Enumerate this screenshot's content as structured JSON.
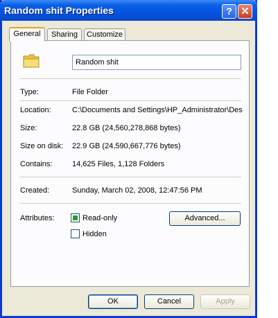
{
  "window": {
    "title": "Random shit Properties",
    "help_label": "?",
    "close_label": "✕"
  },
  "tabs": [
    {
      "label": "General",
      "active": true
    },
    {
      "label": "Sharing",
      "active": false
    },
    {
      "label": "Customize",
      "active": false
    }
  ],
  "general": {
    "folder_name": "Random shit",
    "type_label": "Type:",
    "type_value": "File Folder",
    "location_label": "Location:",
    "location_value": "C:\\Documents and Settings\\HP_Administrator\\Des",
    "size_label": "Size:",
    "size_value": "22.8 GB (24,560,278,868 bytes)",
    "size_on_disk_label": "Size on disk:",
    "size_on_disk_value": "22.9 GB (24,590,667,776 bytes)",
    "contains_label": "Contains:",
    "contains_value": "14,625 Files, 1,128 Folders",
    "created_label": "Created:",
    "created_value": "Sunday, March 02, 2008, 12:47:56 PM",
    "attributes_label": "Attributes:",
    "readonly_label": "Read-only",
    "readonly_checked": true,
    "hidden_label": "Hidden",
    "hidden_checked": false,
    "advanced_label": "Advanced..."
  },
  "buttons": {
    "ok": "OK",
    "cancel": "Cancel",
    "apply": "Apply"
  },
  "icons": {
    "folder": "folder-icon",
    "help": "help-icon",
    "close": "close-icon"
  },
  "colors": {
    "titlebar": "#0354e0",
    "face": "#ece9d8",
    "tab_accent": "#e8a01f"
  }
}
